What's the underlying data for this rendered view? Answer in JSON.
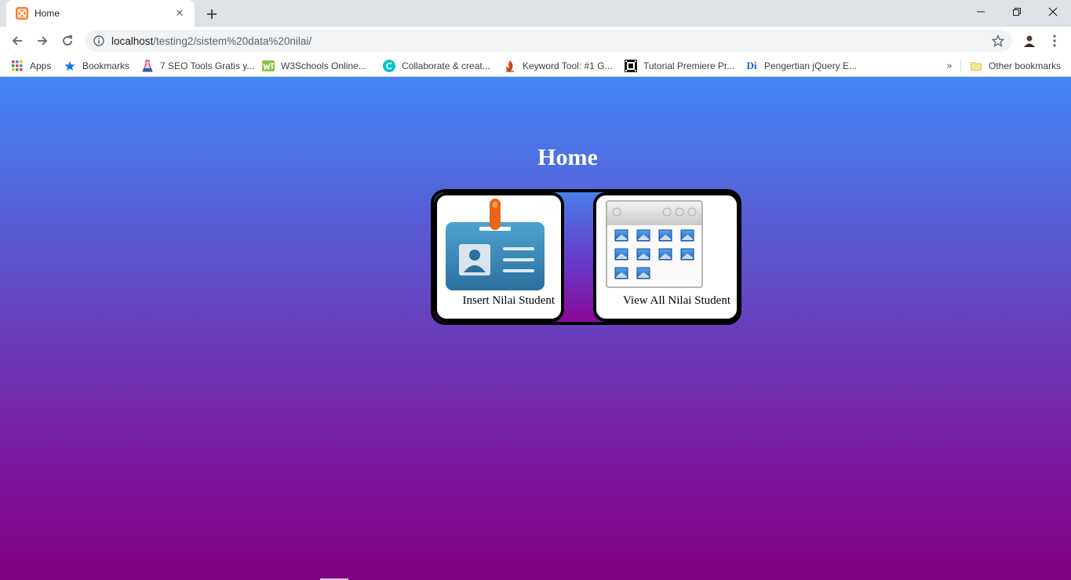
{
  "browser": {
    "tab": {
      "title": "Home"
    },
    "address": {
      "host": "localhost",
      "path": "/testing2/sistem%20data%20nilai/"
    },
    "bookmarks": [
      {
        "label": "Apps",
        "icon": "apps-grid-icon"
      },
      {
        "label": "Bookmarks",
        "icon": "bookmark-star-icon"
      },
      {
        "label": "7 SEO Tools Gratis y...",
        "icon": "flask-icon"
      },
      {
        "label": "W3Schools Online...",
        "icon": "w3schools-icon"
      },
      {
        "label": "Collaborate & creat...",
        "icon": "canva-icon"
      },
      {
        "label": "Keyword Tool: #1 G...",
        "icon": "flame-icon"
      },
      {
        "label": "Tutorial Premiere Pr...",
        "icon": "film-icon"
      },
      {
        "label": "Pengertian jQuery E...",
        "icon": "di-icon"
      }
    ],
    "other_bookmarks": "Other bookmarks"
  },
  "page": {
    "title": "Home",
    "menu": [
      {
        "label": "Insert Nilai Student",
        "icon": "id-card-icon"
      },
      {
        "label": "View All Nilai Student",
        "icon": "image-gallery-icon"
      }
    ]
  },
  "colors": {
    "gradient_top": "#4287f5",
    "gradient_bottom": "#800080",
    "favicon": "#fb7a24"
  }
}
